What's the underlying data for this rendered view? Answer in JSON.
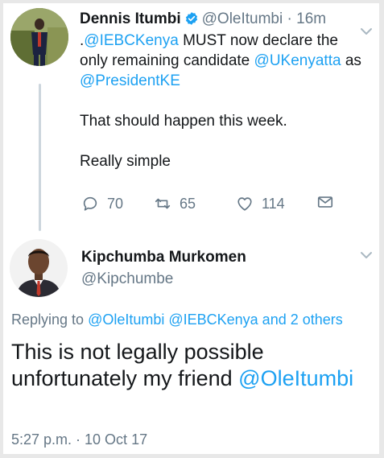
{
  "tweet1": {
    "author_name": "Dennis Itumbi",
    "handle": "@OleItumbi",
    "separator": "·",
    "time": "16m",
    "body_line1_prefix": ".",
    "mention_iebc": "@IEBCKenya",
    "body_line1_text": " MUST now declare the only remaining candidate ",
    "mention_uhuru": "@UKenyatta",
    "body_as": "as ",
    "mention_president": "@PresidentKE",
    "paragraph2": "That should happen this week.",
    "paragraph3": "Really simple",
    "reply_count": "70",
    "retweet_count": "65",
    "like_count": "114",
    "icons": [
      "verified-icon",
      "chevron-down-icon",
      "reply-icon",
      "retweet-icon",
      "like-icon",
      "direct-message-icon"
    ]
  },
  "tweet2": {
    "author_name": "Kipchumba Murkomen",
    "handle": "@Kipchumbe",
    "replying_prefix": "Replying to ",
    "replying_mentions": "@OleItumbi @IEBCKenya and 2 others",
    "body_text": "This is not legally possible unfortunately my friend ",
    "body_mention": "@OleItumbi",
    "timestamp": "5:27 p.m. · 10 Oct 17"
  },
  "colors": {
    "link": "#1da1f2",
    "muted": "#657786",
    "text": "#14171a",
    "thread_line": "#ccd6dd"
  }
}
